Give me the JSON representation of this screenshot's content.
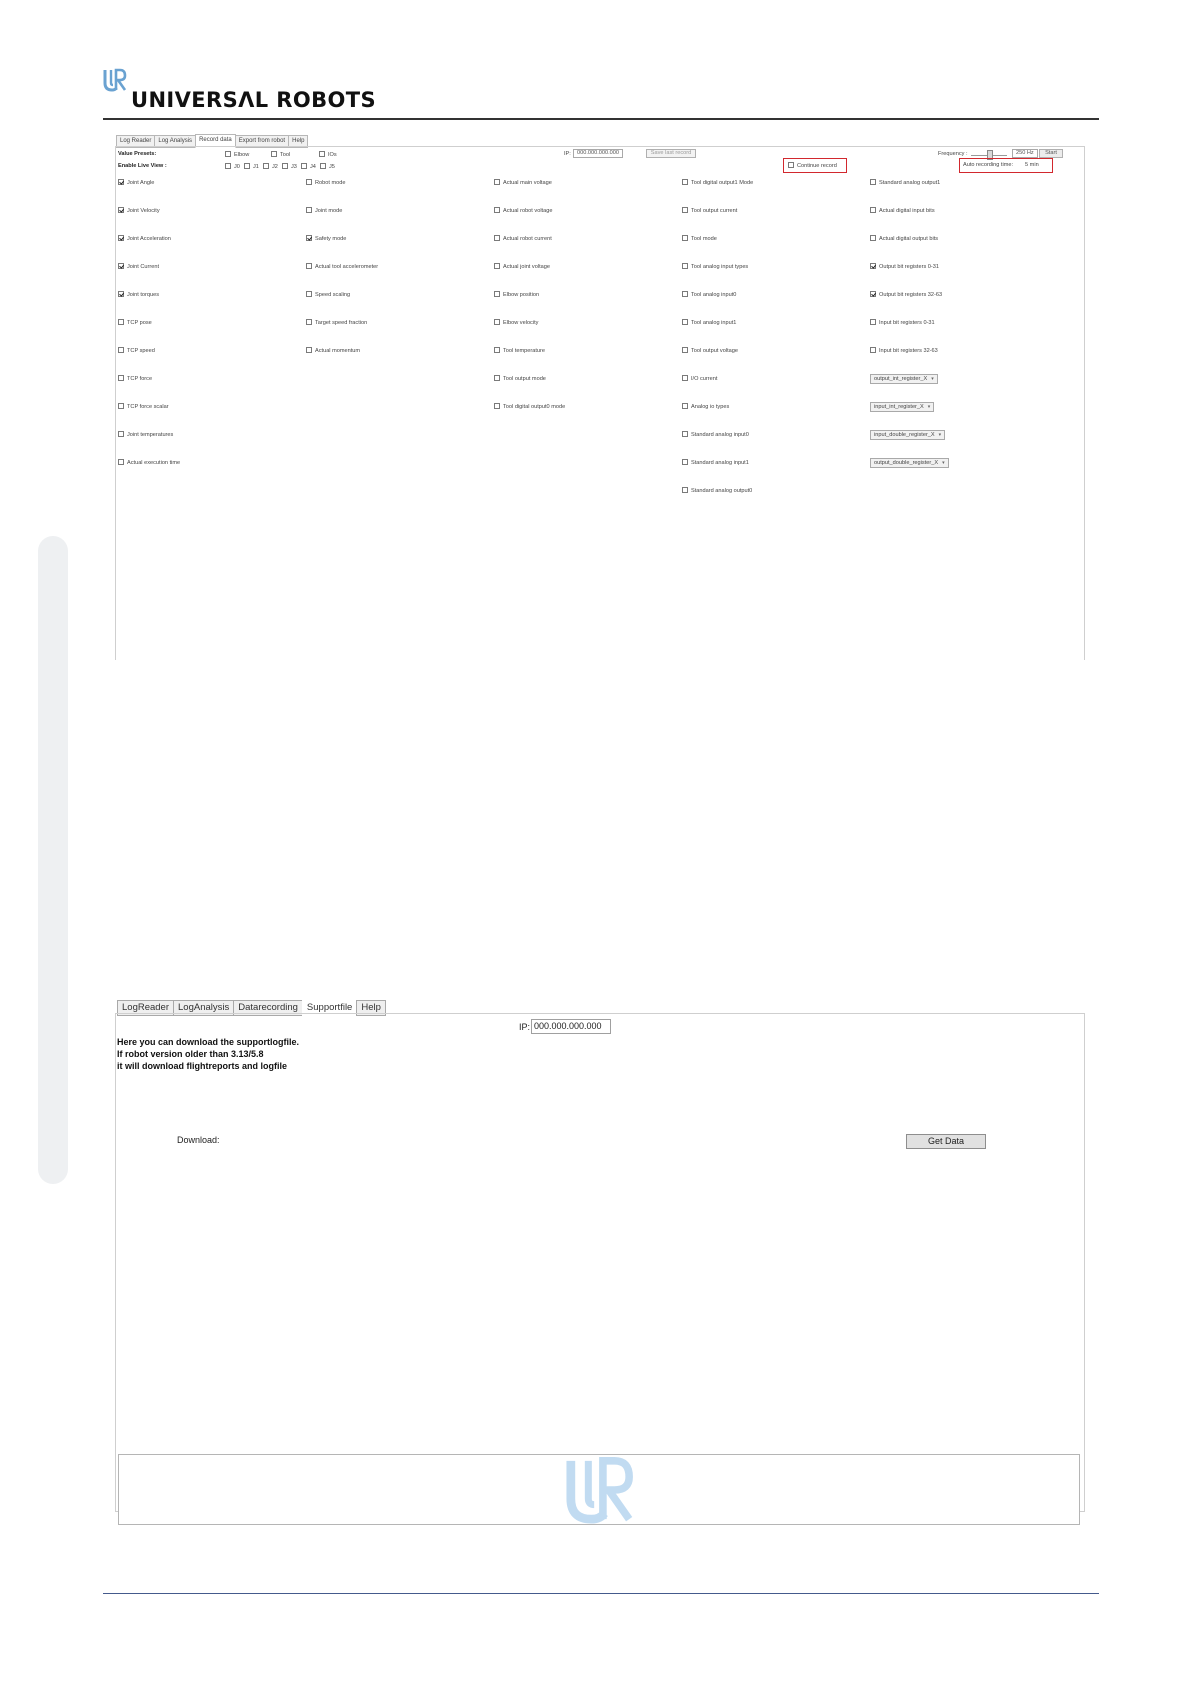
{
  "header": {
    "brand": "UNIVERSΛL ROBOTS",
    "logo_icon": "ur-logo-icon",
    "brand_color": "#6aa2d1"
  },
  "record_data": {
    "tabs": [
      "Log Reader",
      "Log Analysis",
      "Record data",
      "Export from robot",
      "Help"
    ],
    "active_tab": "Record data",
    "value_presets_label": "Value Presets:",
    "presets": [
      {
        "label": "Elbow",
        "checked": false
      },
      {
        "label": "Tool",
        "checked": false
      },
      {
        "label": "IOs",
        "checked": false
      }
    ],
    "enable_live_view_label": "Enable Live View :",
    "live_joints": [
      {
        "label": "J0",
        "checked": false
      },
      {
        "label": "J1",
        "checked": false
      },
      {
        "label": "J2",
        "checked": false
      },
      {
        "label": "J3",
        "checked": false
      },
      {
        "label": "J4",
        "checked": false
      },
      {
        "label": "J5",
        "checked": false
      }
    ],
    "ip_label": "IP:",
    "ip_value": "000.000.000.000",
    "save_last_record": "Save last record",
    "continue_record": "Continue record",
    "continue_record_checked": false,
    "frequency_label": "Frequency :",
    "frequency_value": "250 Hz",
    "start_button": "Start",
    "auto_recording_label": "Auto recording time:",
    "auto_recording_value": "5 min",
    "highlight_color": "#d2282e",
    "columns": [
      [
        {
          "label": "Joint Angle",
          "checked": true
        },
        {
          "label": "Joint Velocity",
          "checked": true
        },
        {
          "label": "Joint Acceleration",
          "checked": true
        },
        {
          "label": "Joint Current",
          "checked": true
        },
        {
          "label": "Joint torques",
          "checked": true
        },
        {
          "label": "TCP pose",
          "checked": false
        },
        {
          "label": "TCP speed",
          "checked": false
        },
        {
          "label": "TCP force",
          "checked": false
        },
        {
          "label": "TCP force scalar",
          "checked": false
        },
        {
          "label": "Joint temperatures",
          "checked": false
        },
        {
          "label": "Actual execution time",
          "checked": false
        }
      ],
      [
        {
          "label": "Robot mode",
          "checked": false
        },
        {
          "label": "Joint mode",
          "checked": false
        },
        {
          "label": "Safety mode",
          "checked": true
        },
        {
          "label": "Actual tool accelerometer",
          "checked": false
        },
        {
          "label": "Speed scaling",
          "checked": false
        },
        {
          "label": "Target speed fraction",
          "checked": false
        },
        {
          "label": "Actual momentum",
          "checked": false
        }
      ],
      [
        {
          "label": "Actual main voltage",
          "checked": false
        },
        {
          "label": "Actual robot voltage",
          "checked": false
        },
        {
          "label": "Actual robot current",
          "checked": false
        },
        {
          "label": "Actual joint voltage",
          "checked": false
        },
        {
          "label": "Elbow position",
          "checked": false
        },
        {
          "label": "Elbow velocity",
          "checked": false
        },
        {
          "label": "Tool temperature",
          "checked": false
        },
        {
          "label": "Tool output mode",
          "checked": false
        },
        {
          "label": "Tool digital output0 mode",
          "checked": false
        }
      ],
      [
        {
          "label": "Tool digital output1 Mode",
          "checked": false
        },
        {
          "label": "Tool output current",
          "checked": false
        },
        {
          "label": "Tool mode",
          "checked": false
        },
        {
          "label": "Tool analog input types",
          "checked": false
        },
        {
          "label": "Tool analog input0",
          "checked": false
        },
        {
          "label": "Tool analog input1",
          "checked": false
        },
        {
          "label": "Tool output voltage",
          "checked": false
        },
        {
          "label": "I/O current",
          "checked": false
        },
        {
          "label": "Analog io types",
          "checked": false
        },
        {
          "label": "Standard analog input0",
          "checked": false
        },
        {
          "label": "Standard analog input1",
          "checked": false
        },
        {
          "label": "Standard analog output0",
          "checked": false
        }
      ],
      [
        {
          "label": "Standard analog output1",
          "checked": false
        },
        {
          "label": "Actual digital input bits",
          "checked": false
        },
        {
          "label": "Actual digital output bits",
          "checked": false
        },
        {
          "label": "Output bit registers 0-31",
          "checked": true
        },
        {
          "label": "Output bit registers 32-63",
          "checked": true
        },
        {
          "label": "Input bit registers 0-31",
          "checked": false
        },
        {
          "label": "Input bit registers 32-63",
          "checked": false
        }
      ]
    ],
    "register_selects": [
      "output_int_register_X",
      "input_int_register_X",
      "input_double_register_X",
      "output_double_register_X"
    ]
  },
  "supportfile": {
    "tabs": [
      "LogReader",
      "LogAnalysis",
      "Datarecording",
      "Supportfile",
      "Help"
    ],
    "active_tab": "Supportfile",
    "ip_label": "IP:",
    "ip_value": "000.000.000.000",
    "info_lines": [
      "Here you can download the supportlogfile.",
      "If robot version older than 3.13/5.8",
      "it will download flightreports and logfile"
    ],
    "download_label": "Download:",
    "get_data_button": "Get Data",
    "watermark_icon": "ur-watermark-icon"
  }
}
